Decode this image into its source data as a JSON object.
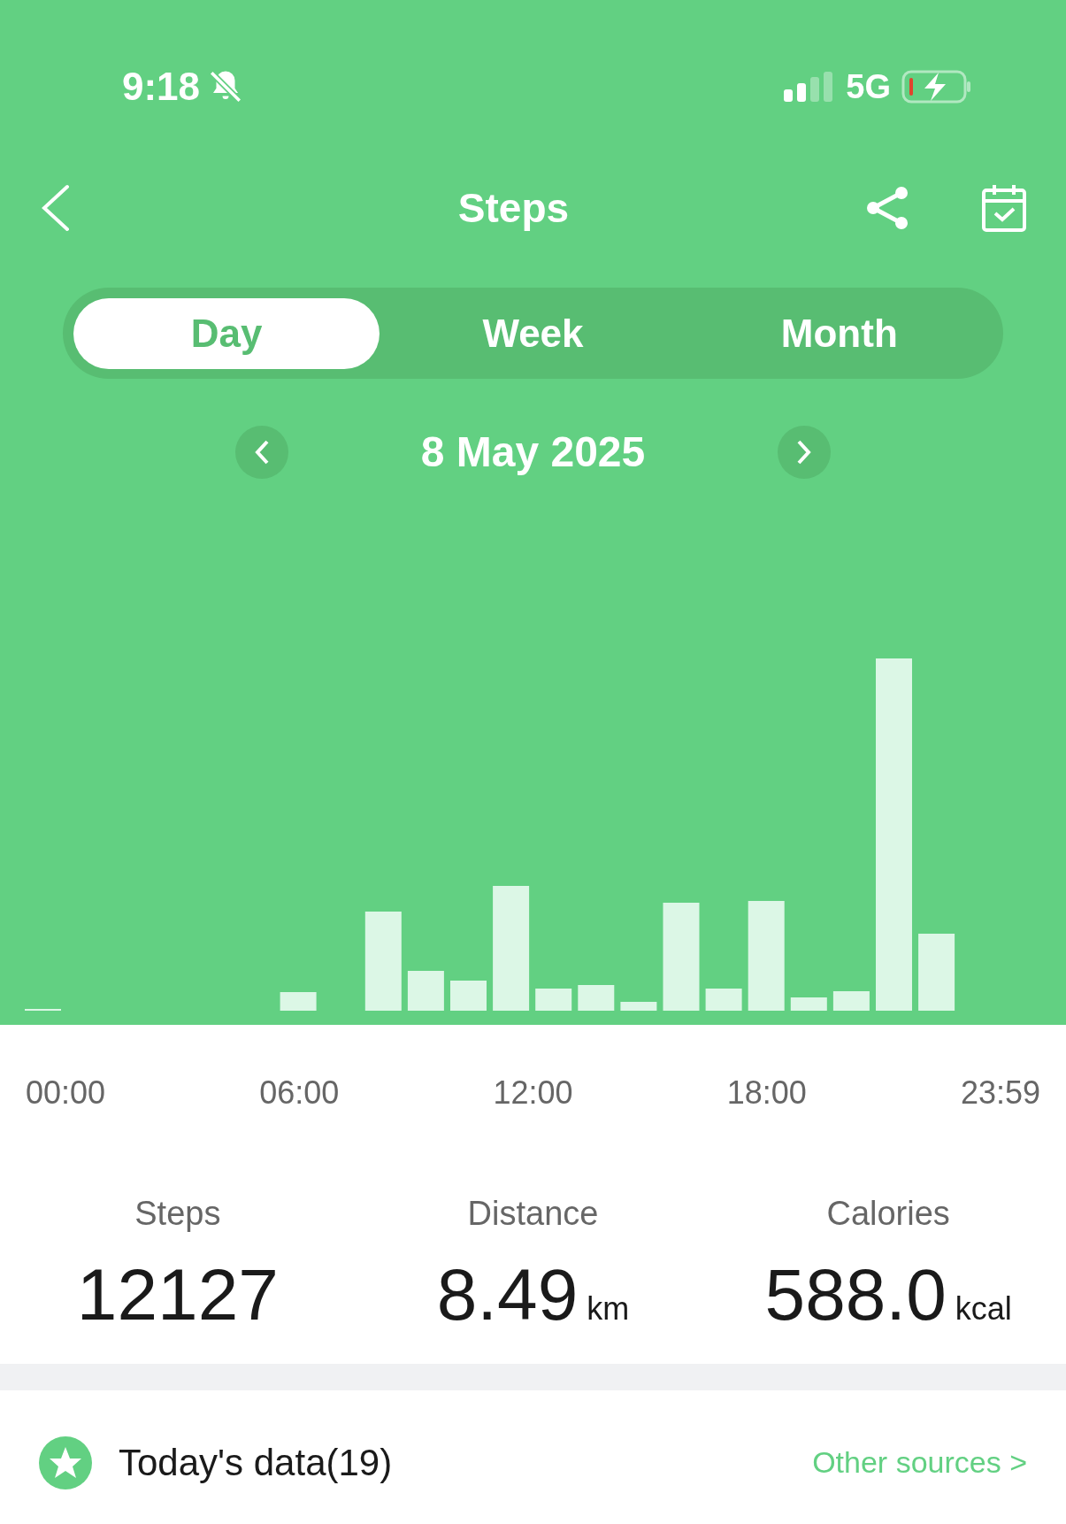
{
  "status_bar": {
    "time": "9:18",
    "network": "5G"
  },
  "header": {
    "title": "Steps"
  },
  "tabs": [
    {
      "label": "Day",
      "selected": true
    },
    {
      "label": "Week",
      "selected": false
    },
    {
      "label": "Month",
      "selected": false
    }
  ],
  "date": "8 May 2025",
  "time_axis": [
    "00:00",
    "06:00",
    "12:00",
    "18:00",
    "23:59"
  ],
  "stats": [
    {
      "label": "Steps",
      "value": "12127"
    },
    {
      "label": "Distance",
      "value": "8.49",
      "unit": "km"
    },
    {
      "label": "Calories",
      "value": "588.0",
      "unit": "kcal"
    }
  ],
  "today": {
    "title": "Today's data(19)",
    "link": "Other sources >"
  }
}
